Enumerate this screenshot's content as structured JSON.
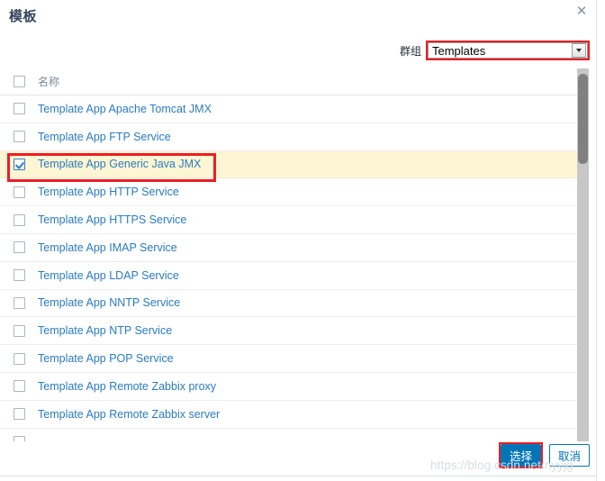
{
  "dialog": {
    "title": "模板",
    "close_icon": "close-icon",
    "close_glyph": "✕"
  },
  "filter": {
    "label": "群组",
    "selected_value": "Templates",
    "options": [
      "Templates"
    ],
    "highlight_color": "#ee1c24"
  },
  "table": {
    "header": {
      "name_column": "名称"
    },
    "rows": [
      {
        "name": "Template App Apache Tomcat JMX",
        "checked": false
      },
      {
        "name": "Template App FTP Service",
        "checked": false
      },
      {
        "name": "Template App Generic Java JMX",
        "checked": true
      },
      {
        "name": "Template App HTTP Service",
        "checked": false
      },
      {
        "name": "Template App HTTPS Service",
        "checked": false
      },
      {
        "name": "Template App IMAP Service",
        "checked": false
      },
      {
        "name": "Template App LDAP Service",
        "checked": false
      },
      {
        "name": "Template App NNTP Service",
        "checked": false
      },
      {
        "name": "Template App NTP Service",
        "checked": false
      },
      {
        "name": "Template App POP Service",
        "checked": false
      },
      {
        "name": "Template App Remote Zabbix proxy",
        "checked": false
      },
      {
        "name": "Template App Remote Zabbix server",
        "checked": false
      },
      {
        "name": "",
        "checked": false
      }
    ]
  },
  "footer": {
    "select_button": "选择",
    "cancel_button": "取消"
  },
  "watermark": {
    "text": "https://blog.csdn.net/nyyjg"
  },
  "colors": {
    "link": "#2a7bbf",
    "primary_button": "#0275b8",
    "selected_row": "#fdf6d4",
    "highlight": "#ee1c24",
    "title": "#33455c"
  }
}
